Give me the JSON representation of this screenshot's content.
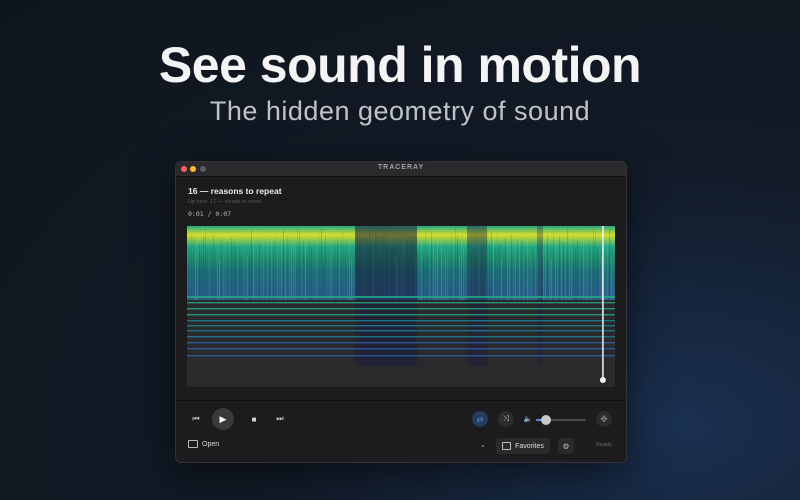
{
  "promo": {
    "headline": "See sound in motion",
    "subhead": "The hidden geometry of sound"
  },
  "window": {
    "title": "TRACERAY",
    "track_title": "16 — reasons to repeat",
    "up_next": "Up next: 17 — clouds in mono",
    "timecode": "0:01 / 0:07",
    "playhead_fraction": 0.97,
    "volume_fraction": 0.2
  },
  "controls": {
    "prev_icon": "⏮",
    "play_icon": "▶",
    "stop_icon": "■",
    "next_icon": "⏭",
    "repeat_icon": "⇄",
    "shuffle_icon": "⤨",
    "volume_icon": "🔈",
    "move_icon": "✥",
    "chevron_icon": "⌄",
    "gear_icon": "⚙"
  },
  "bottom_bar": {
    "open_label": "Open",
    "favorites_label": "Favorites",
    "status": "Ready"
  },
  "colors": {
    "accent": "#5d8ee0",
    "spectro_high": "#d8df2a",
    "spectro_mid": "#22a884",
    "spectro_low": "#2c5b8a"
  }
}
